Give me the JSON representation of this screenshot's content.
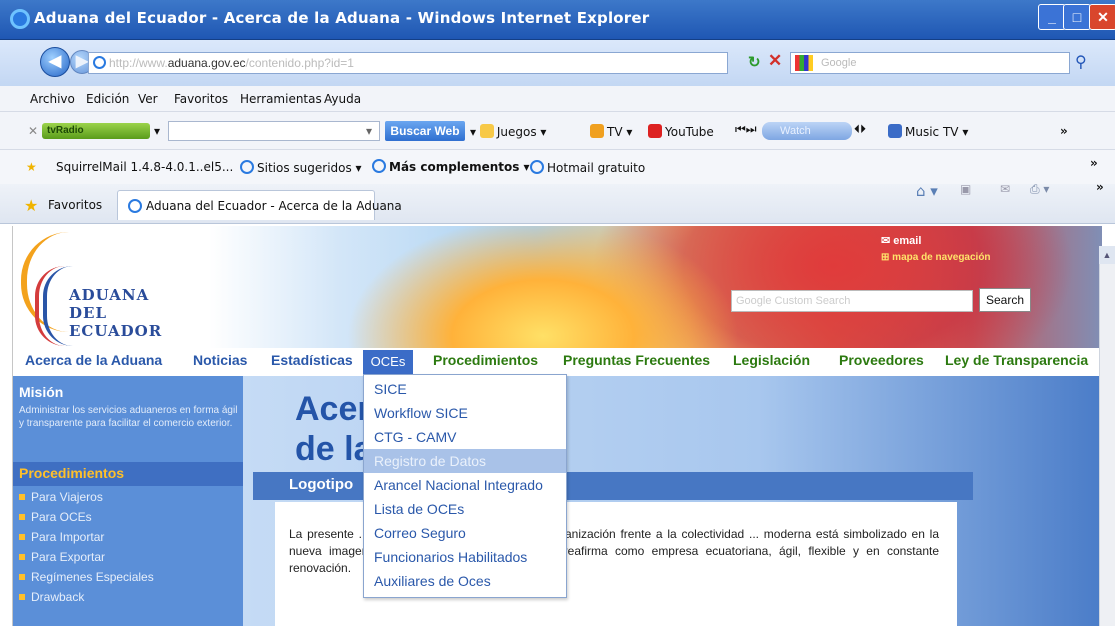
{
  "window": {
    "title": "Aduana del Ecuador - Acerca de la Aduana - Windows Internet Explorer"
  },
  "address": {
    "url_domain": "aduana.gov.ec",
    "search_placeholder": "Google"
  },
  "menu": {
    "items": [
      "Archivo",
      "Edición",
      "Ver",
      "Favoritos",
      "Herramientas",
      "Ayuda"
    ]
  },
  "toolbar": {
    "tvradio": "tvRadio",
    "buscar_web": "Buscar Web",
    "juegos": "Juegos",
    "tv": "TV",
    "youtube": "YouTube",
    "watch": "Watch",
    "music_tv": "Music TV"
  },
  "links": {
    "squirrelmail": "SquirrelMail 1.4.8-4.0.1..el5...",
    "sitios": "Sitios sugeridos",
    "complementos": "Más complementos",
    "hotmail": "Hotmail gratuito"
  },
  "tabs": {
    "favoritos": "Favoritos",
    "active_tab": "Aduana del Ecuador - Acerca de la Aduana"
  },
  "site": {
    "logo_lines": [
      "ADUANA",
      "DEL",
      "ECUADOR"
    ],
    "email": "email",
    "mapa": "mapa de navegación",
    "search_placeholder": "Google Custom Search",
    "search_button": "Search",
    "nav": [
      "Acerca de la Aduana",
      "Noticias",
      "Estadísticas",
      "OCEs",
      "Procedimientos",
      "Preguntas Frecuentes",
      "Legislación",
      "Proveedores",
      "Ley de Transparencia"
    ],
    "oces_menu": [
      "SICE",
      "Workflow SICE",
      "CTG - CAMV",
      "Registro de Datos",
      "Arancel Nacional Integrado",
      "Lista de OCEs",
      "Correo Seguro",
      "Funcionarios Habilitados",
      "Auxiliares de Oces"
    ],
    "mision_title": "Misión",
    "mision_text": "Administrar los servicios aduaneros en forma ágil y transparente para facilitar el comercio exterior.",
    "proc_title": "Procedimientos",
    "proc_items": [
      "Para Viajeros",
      "Para OCEs",
      "Para Importar",
      "Para Exportar",
      "Regímenes Especiales",
      "Drawback"
    ],
    "heading_1": "Acer",
    "heading_2": "de la",
    "section_title": "Logotipo",
    "paragraph": "La presente ... do en cambiar la imagen de la organización frente a la colectividad ... moderna está simbolizado en la nueva imagen corporativa expresada a ... nos reafirma como empresa ecuatoriana, ágil, flexible y en constante renovación."
  }
}
